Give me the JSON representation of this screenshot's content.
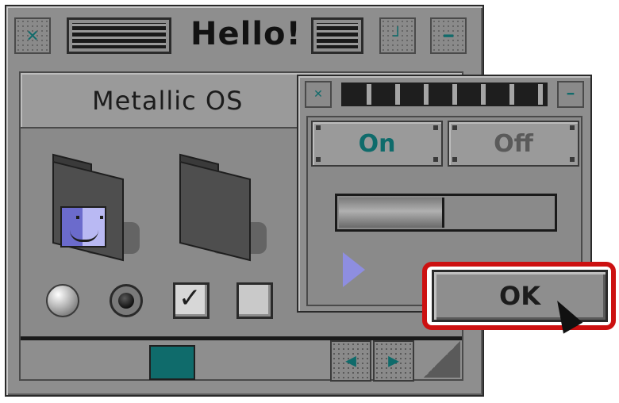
{
  "window": {
    "title": "Hello!",
    "header_label": "Metallic OS"
  },
  "settings": {
    "on_label": "On",
    "off_label": "Off",
    "slider_level": 0.48,
    "ok_label": "OK"
  },
  "colors": {
    "accent_teal": "#0f6b6b",
    "highlight_red": "#cc1111",
    "finder_blue": "#6b6bcc",
    "arrow_lilac": "#8e8ee0"
  },
  "icons": {
    "close": "x-icon",
    "zoom": "resize-icon",
    "collapse": "minus-icon",
    "folder": "folder-icon",
    "finder": "finder-face-icon"
  }
}
